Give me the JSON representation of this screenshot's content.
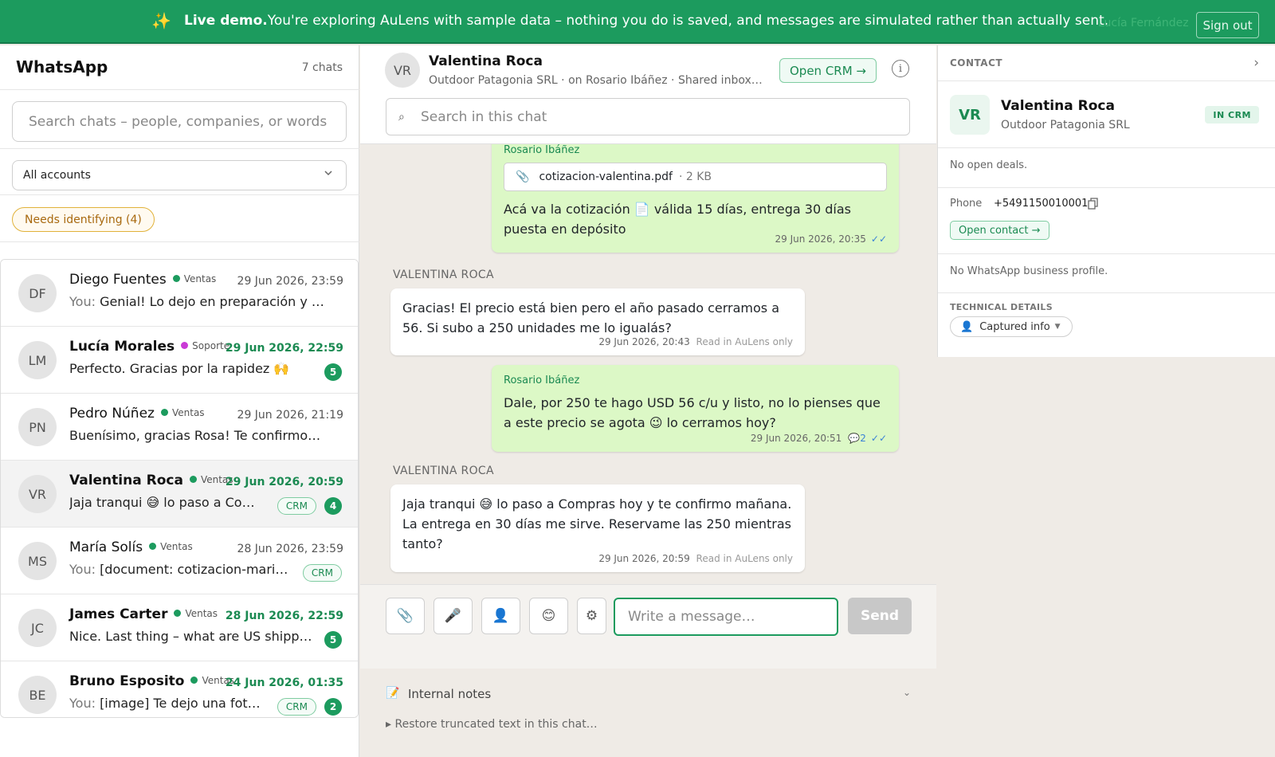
{
  "banner": {
    "spark_icon": "sparkles-icon",
    "bold": "Live demo.",
    "text": "You're exploring AuLens with sample data – nothing you do is saved, and messages are simulated rather than actually sent.",
    "user": "Lucía Fernández",
    "sign_out": "Sign out"
  },
  "sidebar": {
    "title": "WhatsApp",
    "count": "7 chats",
    "search_placeholder": "Search chats – people, companies, or words",
    "account_filter": "All accounts",
    "needs_identifying": "Needs identifying  (4)"
  },
  "chats": [
    {
      "initials": "DF",
      "name": "Diego Fuentes",
      "tag": "Ventas",
      "tag_color": "#1c9b5e",
      "time": "29 Jun 2026, 23:59",
      "you": "You: ",
      "preview": "Genial! Lo dejo en preparación y …",
      "crm": "",
      "count": "",
      "unread": false,
      "active": false
    },
    {
      "initials": "LM",
      "name": "Lucía Morales",
      "tag": "Soporte",
      "tag_color": "#c93ad6",
      "time": "29 Jun 2026, 22:59",
      "you": "",
      "preview": "Perfecto. Gracias por la rapidez 🙌",
      "crm": "",
      "count": "5",
      "unread": true,
      "active": false
    },
    {
      "initials": "PN",
      "name": "Pedro Núñez",
      "tag": "Ventas",
      "tag_color": "#1c9b5e",
      "time": "29 Jun 2026, 21:19",
      "you": "",
      "preview": "Buenísimo, gracias Rosa! Te confirmo …",
      "crm": "",
      "count": "",
      "unread": false,
      "active": false
    },
    {
      "initials": "VR",
      "name": "Valentina Roca",
      "tag": "Ventas",
      "tag_color": "#1c9b5e",
      "time": "29 Jun 2026, 20:59",
      "you": "",
      "preview": "Jaja tranqui 😅  lo paso a Co…",
      "crm": "CRM",
      "count": "4",
      "unread": true,
      "active": true
    },
    {
      "initials": "MS",
      "name": "María Solís",
      "tag": "Ventas",
      "tag_color": "#1c9b5e",
      "time": "28 Jun 2026, 23:59",
      "you": "You: ",
      "preview": "[document: cotizacion-mari…",
      "crm": "CRM",
      "count": "",
      "unread": false,
      "active": false
    },
    {
      "initials": "JC",
      "name": "James Carter",
      "tag": "Ventas",
      "tag_color": "#1c9b5e",
      "time": "28 Jun 2026, 22:59",
      "you": "",
      "preview": "Nice. Last thing – what are US shipp…",
      "crm": "",
      "count": "5",
      "unread": true,
      "active": false
    },
    {
      "initials": "BE",
      "name": "Bruno Esposito",
      "tag": "Ventas",
      "tag_color": "#1c9b5e",
      "time": "24 Jun 2026, 01:35",
      "you": "You: ",
      "preview": "[image] Te dejo una fot…",
      "crm": "CRM",
      "count": "2",
      "unread": true,
      "active": false
    }
  ],
  "conversation": {
    "initials": "VR",
    "name": "Valentina Roca",
    "subtitle": "Outdoor Patagonia SRL · on Rosario Ibáñez · Shared inbox · read r…",
    "open_crm": "Open CRM →",
    "info_icon": "info-icon",
    "search_placeholder": "Search in this chat",
    "messages": {
      "m1": {
        "author": "Rosario Ibáñez",
        "file": "cotizacion-valentina.pdf",
        "file_size": "· 2 KB",
        "text": "Acá va la cotización 📄  válida 15 días, entrega 30 días puesta en depósito",
        "time": "29 Jun 2026, 20:35",
        "ticks": "✓✓"
      },
      "label2": "VALENTINA ROCA",
      "m2": {
        "text": "Gracias! El precio está bien pero el año pasado cerramos a 56. Si subo a 250 unidades me lo igualás?",
        "time": "29 Jun 2026, 20:43",
        "note": "Read in AuLens only"
      },
      "m3": {
        "author": "Rosario Ibáñez",
        "text": "Dale, por 250 te hago USD 56 c/u y listo, no lo pienses que a este precio se agota 😉  lo cerramos hoy?",
        "time": "29 Jun 2026, 20:51",
        "replies": "💬2",
        "ticks": "✓✓"
      },
      "label4": "VALENTINA ROCA",
      "m4": {
        "text": "Jaja tranqui 😅  lo paso a Compras hoy y te confirmo mañana. La entrega en 30 días me sirve. Reservame las 250 mientras tanto?",
        "time": "29 Jun 2026, 20:59",
        "note": "Read in AuLens only"
      }
    },
    "composer": {
      "placeholder": "Write a message…",
      "send": "Send",
      "tools": [
        "paperclip-icon",
        "microphone-icon",
        "contact-icon",
        "emoji-icon",
        "settings-icon"
      ]
    },
    "notes": {
      "title": "Internal notes",
      "restore": "▸ Restore truncated text in this chat…"
    }
  },
  "contact": {
    "header": "CONTACT",
    "initials": "VR",
    "name": "Valentina Roca",
    "company": "Outdoor Patagonia SRL",
    "badge": "IN CRM",
    "deals": "No open deals.",
    "phone_label": "Phone",
    "phone": "+5491150010001",
    "open_contact": "Open contact →",
    "business_profile": "No WhatsApp business profile.",
    "technical_header": "TECHNICAL DETAILS",
    "captured_info": "Captured info"
  }
}
